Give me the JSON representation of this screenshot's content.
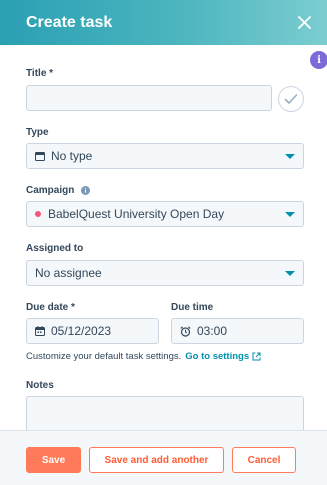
{
  "header": {
    "title": "Create task",
    "close_icon": "close-icon"
  },
  "info_badge": {
    "glyph": "i"
  },
  "form": {
    "title": {
      "label": "Title *",
      "value": ""
    },
    "type": {
      "label": "Type",
      "value": "No type",
      "icon": "task-type-icon"
    },
    "campaign": {
      "label": "Campaign",
      "value": "BabelQuest University Open Day",
      "dot_color": "#f2547d"
    },
    "assigned_to": {
      "label": "Assigned to",
      "value": "No assignee"
    },
    "due_date": {
      "label": "Due date *",
      "value": "05/12/2023"
    },
    "due_time": {
      "label": "Due time",
      "value": "03:00"
    },
    "helper_text": "Customize your default task settings.",
    "helper_link": "Go to settings",
    "notes": {
      "label": "Notes",
      "value": ""
    }
  },
  "footer": {
    "save_label": "Save",
    "save_add_label": "Save and add another",
    "cancel_label": "Cancel"
  },
  "colors": {
    "accent": "#0091ae",
    "primary_button": "#ff7a59",
    "header_gradient_start": "#2aa0b3",
    "header_gradient_end": "#7ccdd0"
  }
}
